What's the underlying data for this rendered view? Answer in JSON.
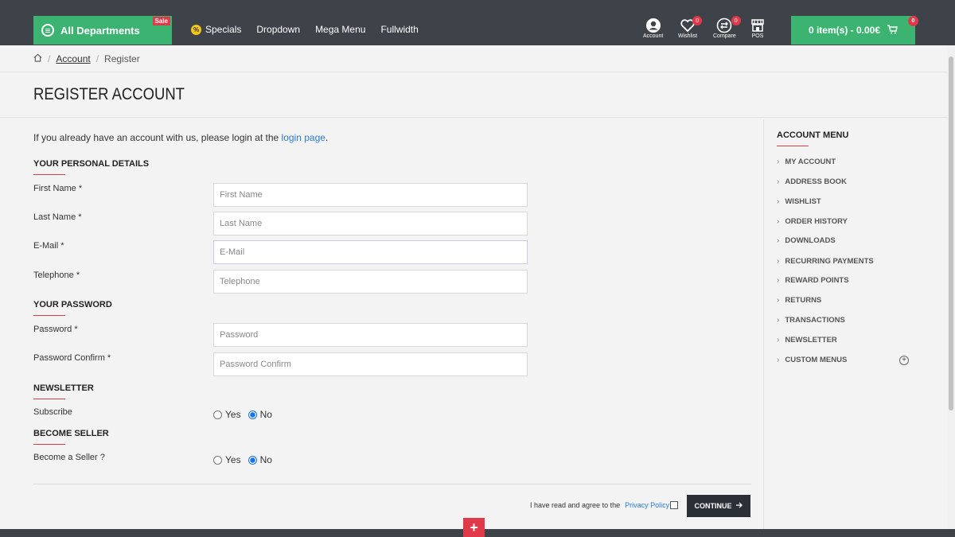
{
  "header": {
    "departments_label": "All Departments",
    "sale_badge": "Sale",
    "nav": [
      "Specials",
      "Dropdown",
      "Mega Menu",
      "Fullwidth"
    ],
    "specials_icon": "%",
    "icons": {
      "account": "Account",
      "wishlist": "Wishlist",
      "wishlist_count": "0",
      "compare": "Compare",
      "compare_count": "0",
      "pos": "POS"
    },
    "cart_label": "0 item(s) - 0.00€",
    "cart_count": "0"
  },
  "breadcrumb": {
    "account": "Account",
    "current": "Register",
    "separator": "/"
  },
  "page_title": "REGISTER ACCOUNT",
  "intro": {
    "text": "If you already have an account with us, please login at the ",
    "link": "login page",
    "end": "."
  },
  "sections": {
    "personal": "YOUR PERSONAL DETAILS",
    "password": "YOUR PASSWORD",
    "newsletter": "NEWSLETTER",
    "seller": "BECOME SELLER"
  },
  "fields": {
    "firstname": {
      "label": "First Name *",
      "placeholder": "First Name",
      "value": ""
    },
    "lastname": {
      "label": "Last Name *",
      "placeholder": "Last Name",
      "value": ""
    },
    "email": {
      "label": "E-Mail *",
      "placeholder": "E-Mail",
      "value": ""
    },
    "telephone": {
      "label": "Telephone *",
      "placeholder": "Telephone",
      "value": ""
    },
    "password": {
      "label": "Password *",
      "placeholder": "Password",
      "value": ""
    },
    "confirm": {
      "label": "Password Confirm *",
      "placeholder": "Password Confirm",
      "value": ""
    }
  },
  "newsletter": {
    "label": "Subscribe",
    "yes": "Yes",
    "no": "No",
    "selected": "No"
  },
  "seller": {
    "label": "Become a Seller ?",
    "yes": "Yes",
    "no": "No",
    "selected": "No"
  },
  "agree": {
    "text": "I have read and agree to the",
    "link": "Privacy Policy",
    "checked": false
  },
  "continue_label": "CONTINUE",
  "sidebar": {
    "title": "ACCOUNT MENU",
    "items": [
      "MY ACCOUNT",
      "ADDRESS BOOK",
      "WISHLIST",
      "ORDER HISTORY",
      "DOWNLOADS",
      "RECURRING PAYMENTS",
      "REWARD POINTS",
      "RETURNS",
      "TRANSACTIONS",
      "NEWSLETTER",
      "CUSTOM MENUS"
    ]
  },
  "colors": {
    "accent_green": "#3cb371",
    "accent_red": "#e03a4a",
    "header_dark": "#3d4349",
    "link_blue": "#2a7bd6"
  }
}
